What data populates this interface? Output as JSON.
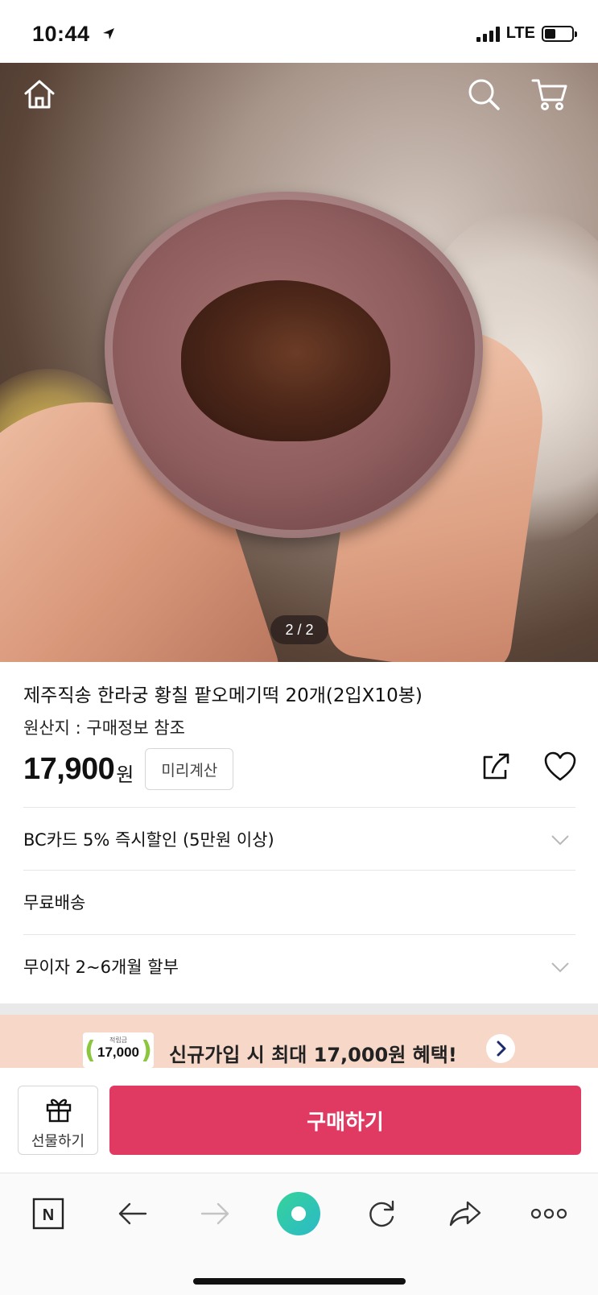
{
  "status_bar": {
    "time": "10:44",
    "network": "LTE"
  },
  "hero": {
    "page_indicator": "2 / 2",
    "icons": [
      "home-icon",
      "search-icon",
      "cart-icon"
    ]
  },
  "product": {
    "title": "제주직송 한라궁 황칠 팥오메기떡 20개(2입X10봉)",
    "origin": "원산지 : 구매정보 참조",
    "price": "17,900",
    "currency": "원",
    "precalc_label": "미리계산"
  },
  "info_rows": [
    {
      "label": "BC카드 5% 즉시할인 (5만원 이상)",
      "expandable": true
    },
    {
      "label": "무료배송",
      "expandable": false
    },
    {
      "label": "무이자 2~6개월 할부",
      "expandable": true
    }
  ],
  "promo": {
    "coin_caption": "적립금",
    "coin_amount": "17,000",
    "text": "신규가입 시 최대 17,000원 혜택!",
    "background": "#f7d8c8",
    "coin_accent": "#8cc63f"
  },
  "actions": {
    "gift_label": "선물하기",
    "buy_label": "구매하기",
    "buy_color": "#e03a63"
  },
  "browser_bar": {
    "logo_letter": "N",
    "icons": [
      "naver-home-icon",
      "back-arrow-icon",
      "forward-arrow-icon",
      "green-dot-icon",
      "reload-icon",
      "share-arrow-icon",
      "more-icon"
    ]
  }
}
